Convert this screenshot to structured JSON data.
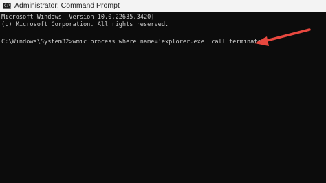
{
  "window": {
    "title": "Administrator: Command Prompt",
    "icon": "command-prompt-icon",
    "icon_glyph": "C:\\"
  },
  "console": {
    "lines": [
      "Microsoft Windows [Version 10.0.22635.3420]",
      "(c) Microsoft Corporation. All rights reserved.",
      "C:\\Windows\\System32>wmic process where name='explorer.exe' call terminate"
    ]
  },
  "annotation": {
    "icon": "red-arrow-icon",
    "color": "#e8483f"
  },
  "colors": {
    "console_background": "#0c0c0c",
    "console_text": "#cccccc",
    "titlebar_background": "#f3f3f3"
  }
}
